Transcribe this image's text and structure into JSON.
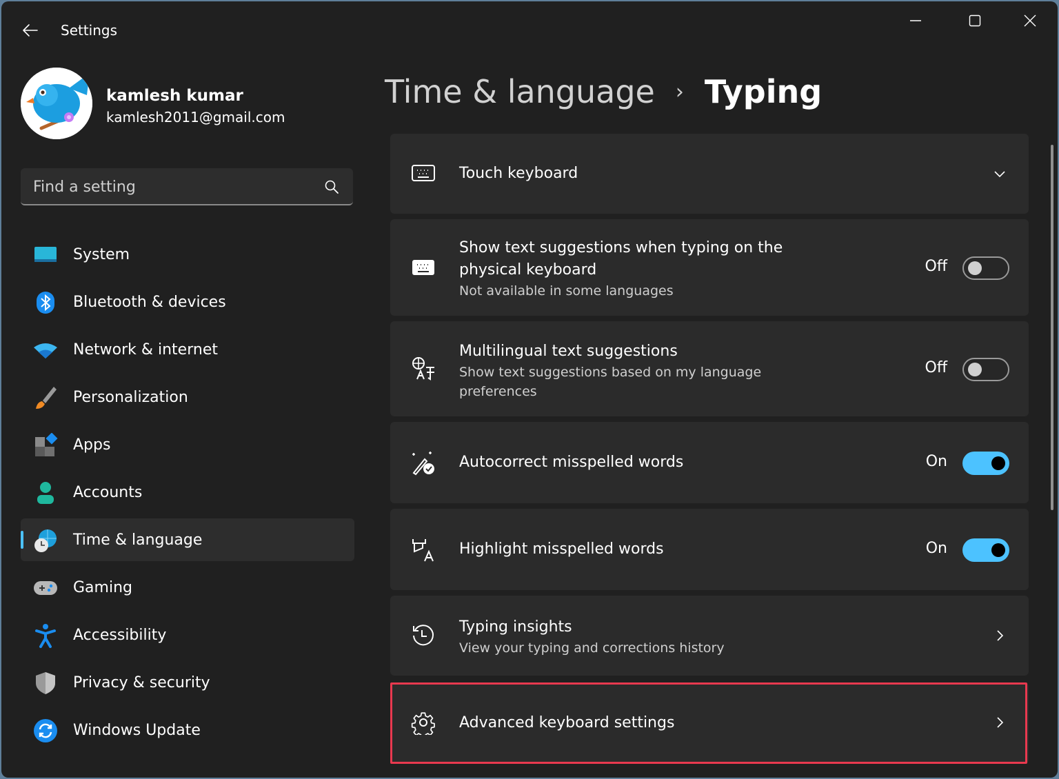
{
  "window": {
    "title": "Settings",
    "controls": {
      "minimize": "minimize-icon",
      "maximize": "maximize-icon",
      "close": "close-icon"
    }
  },
  "profile": {
    "name": "kamlesh kumar",
    "email": "kamlesh2011@gmail.com"
  },
  "search": {
    "placeholder": "Find a setting",
    "value": ""
  },
  "sidebar": {
    "items": [
      {
        "label": "System",
        "icon": "system-icon",
        "active": false
      },
      {
        "label": "Bluetooth & devices",
        "icon": "bluetooth-icon",
        "active": false
      },
      {
        "label": "Network & internet",
        "icon": "wifi-icon",
        "active": false
      },
      {
        "label": "Personalization",
        "icon": "paintbrush-icon",
        "active": false
      },
      {
        "label": "Apps",
        "icon": "apps-icon",
        "active": false
      },
      {
        "label": "Accounts",
        "icon": "person-icon",
        "active": false
      },
      {
        "label": "Time & language",
        "icon": "globe-clock-icon",
        "active": true
      },
      {
        "label": "Gaming",
        "icon": "gamepad-icon",
        "active": false
      },
      {
        "label": "Accessibility",
        "icon": "accessibility-icon",
        "active": false
      },
      {
        "label": "Privacy & security",
        "icon": "shield-icon",
        "active": false
      },
      {
        "label": "Windows Update",
        "icon": "update-icon",
        "active": false
      }
    ]
  },
  "breadcrumb": {
    "parent": "Time & language",
    "separator": "›",
    "current": "Typing"
  },
  "settings": [
    {
      "title": "Touch keyboard",
      "icon": "keyboard-outline-icon",
      "control": "expand"
    },
    {
      "title": "Show text suggestions when typing on the physical keyboard",
      "subtitle": "Not available in some languages",
      "icon": "keyboard-filled-icon",
      "control": "toggle",
      "state": "Off",
      "on": false
    },
    {
      "title": "Multilingual text suggestions",
      "subtitle": "Show text suggestions based on my language preferences",
      "icon": "language-icon",
      "control": "toggle",
      "state": "Off",
      "on": false
    },
    {
      "title": "Autocorrect misspelled words",
      "icon": "autocorrect-icon",
      "control": "toggle",
      "state": "On",
      "on": true
    },
    {
      "title": "Highlight misspelled words",
      "icon": "highlight-text-icon",
      "control": "toggle",
      "state": "On",
      "on": true
    },
    {
      "title": "Typing insights",
      "subtitle": "View your typing and corrections history",
      "icon": "history-icon",
      "control": "navigate"
    },
    {
      "title": "Advanced keyboard settings",
      "icon": "gear-icon",
      "control": "navigate",
      "highlighted": true
    }
  ],
  "colors": {
    "accent": "#4cc2ff",
    "highlight_border": "#e8394f",
    "background": "#202020",
    "card": "#2b2b2b"
  }
}
